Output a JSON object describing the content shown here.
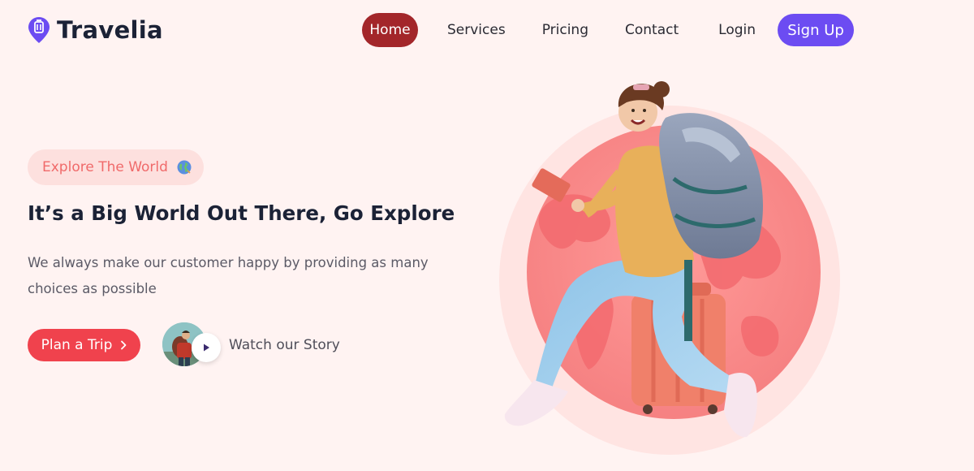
{
  "brand": {
    "name": "Travelia",
    "colors": {
      "primary": "#6c4cf2",
      "accent": "#f0424d",
      "active_nav": "#a3262a",
      "background": "#fff3f2"
    }
  },
  "nav": {
    "items": [
      {
        "label": "Home",
        "active": true
      },
      {
        "label": "Services"
      },
      {
        "label": "Pricing"
      },
      {
        "label": "Contact"
      },
      {
        "label": "Login"
      }
    ],
    "signup_label": "Sign Up"
  },
  "hero": {
    "badge_text": "Explore The World",
    "badge_icon": "globe-icon",
    "title": "It’s a Big World Out There, Go Explore",
    "description": "We always make our customer happy by providing as many choices as possible",
    "cta_label": "Plan a Trip",
    "watch_label": "Watch our Story",
    "watch_icon": "play-icon"
  }
}
